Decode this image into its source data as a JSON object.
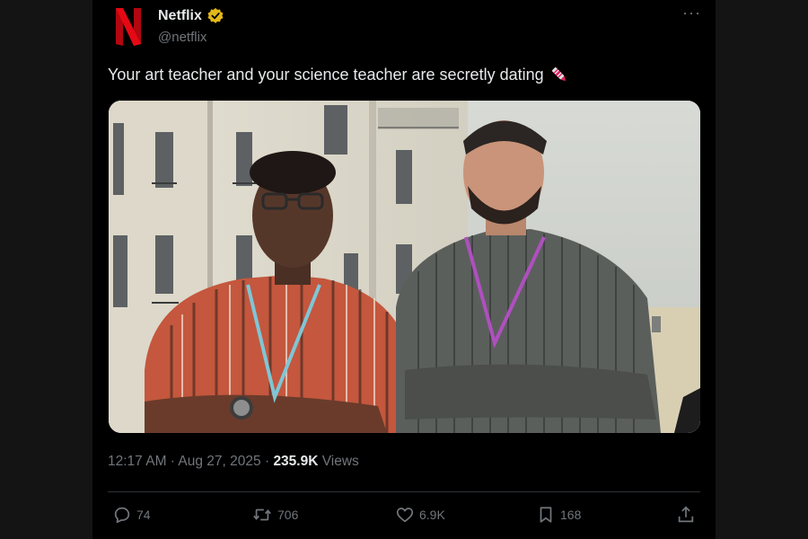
{
  "account": {
    "name": "Netflix",
    "handle": "@netflix",
    "avatar_letter": "N",
    "brand_color": "#e50914",
    "verified_color": "#e2b719"
  },
  "tweet": {
    "text": "Your art teacher and your science teacher are secretly dating",
    "emoji": "crayon-icon",
    "media_alt": "photo",
    "time": "12:17 AM",
    "separator": " · ",
    "date": "Aug 27, 2025",
    "views_count": "235.9K",
    "views_label": " Views"
  },
  "actions": {
    "replies": "74",
    "reposts": "706",
    "likes": "6.9K",
    "bookmarks": "168"
  },
  "menu": {
    "more_label": "···"
  }
}
